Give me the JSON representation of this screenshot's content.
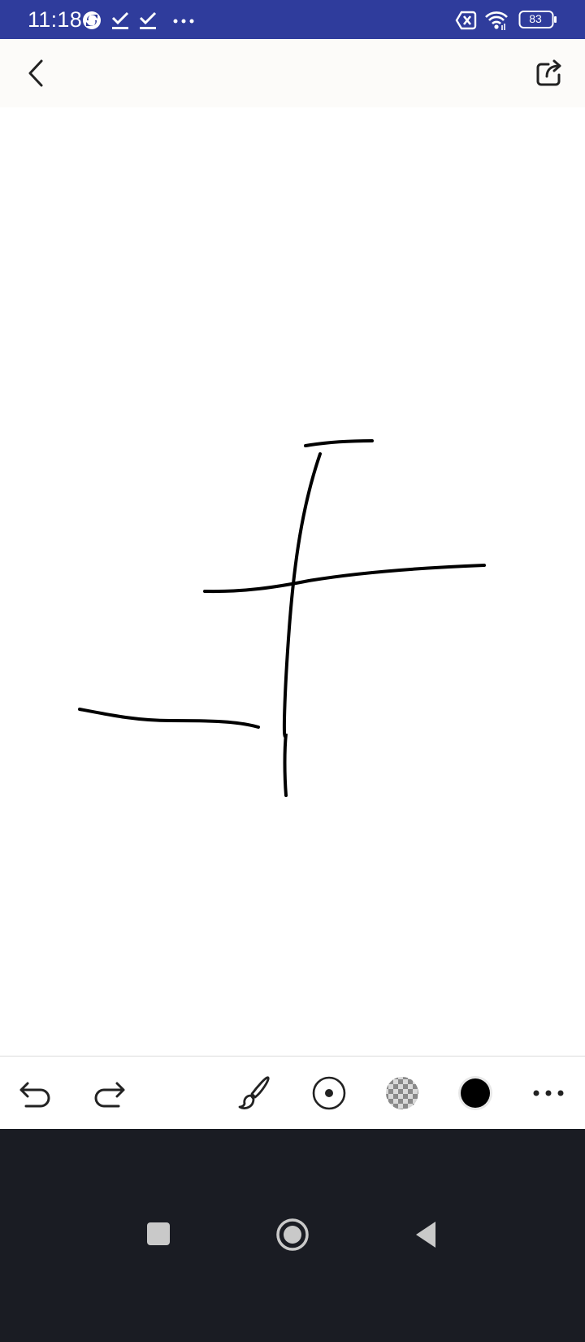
{
  "status_bar": {
    "time": "11:18",
    "battery_level": "83",
    "background_color": "#2f3c9c",
    "left_icons": [
      "sync-icon",
      "download-done-icon",
      "download-done-icon",
      "more-notifications-icon"
    ],
    "right_icons": [
      "no-sim-icon",
      "wifi-icon",
      "battery-icon"
    ]
  },
  "app_bar": {
    "left_icon": "back-arrow-icon",
    "right_icon": "share-icon"
  },
  "canvas": {
    "background_color": "#ffffff",
    "stroke_color": "#000000"
  },
  "toolbar": {
    "tools": [
      "undo-icon",
      "redo-icon",
      "brush-icon",
      "brush-size-icon",
      "opacity-icon",
      "color-picker-icon",
      "more-options-icon"
    ],
    "selected_color": "#000000"
  },
  "nav_bar": {
    "buttons": [
      "recents-square-icon",
      "home-circle-icon",
      "back-triangle-icon"
    ],
    "background_color": "#1a1c23"
  }
}
